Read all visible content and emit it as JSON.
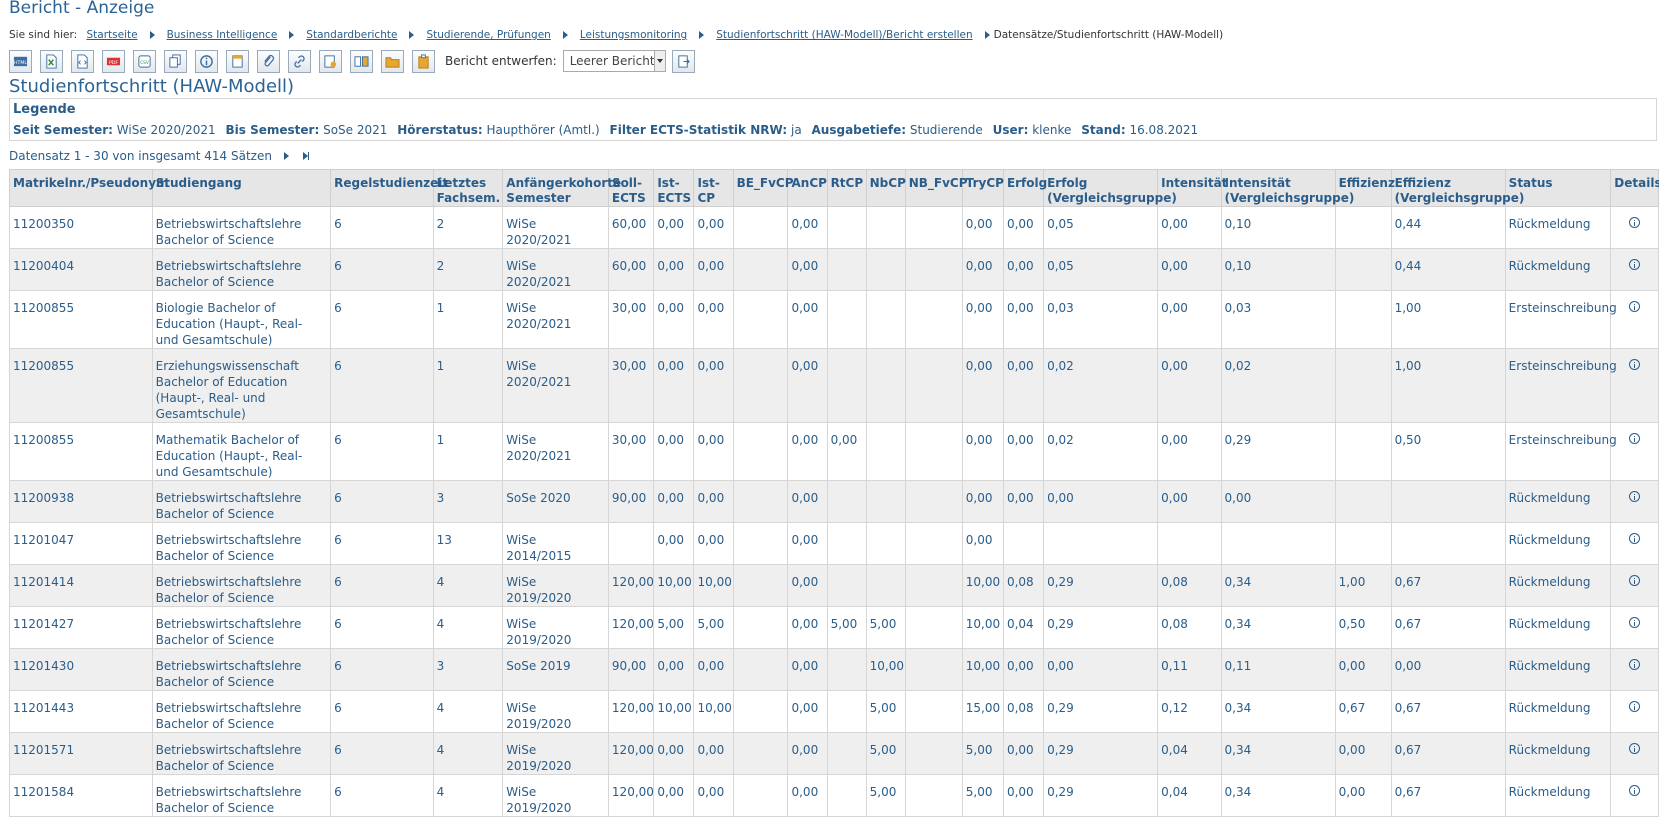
{
  "window": {
    "title": "Bericht - Anzeige"
  },
  "breadcrumb": {
    "prefix": "Sie sind hier:",
    "links": [
      "Startseite",
      "Business Intelligence",
      "Standardberichte",
      "Studierende, Prüfungen",
      "Leistungsmonitoring",
      "Studienfortschritt (HAW-Modell)/Bericht erstellen"
    ],
    "current": "Datensätze/Studienfortschritt (HAW-Modell)"
  },
  "toolbar": {
    "buttons": [
      "html-export-icon",
      "excel-export-icon",
      "xml-export-icon",
      "pdf-export-icon",
      "csv-export-icon",
      "copy-icon",
      "info-icon",
      "bookmark-icon",
      "attach-icon",
      "link-icon",
      "report-settings-icon",
      "compare-icon",
      "folder-icon",
      "clipboard-icon"
    ],
    "design_label": "Bericht entwerfen:",
    "design_value": "Leerer Bericht",
    "apply_icon": "apply-design-icon"
  },
  "report": {
    "title": "Studienfortschritt (HAW-Modell)"
  },
  "legend": {
    "title": "Legende",
    "items": [
      {
        "label": "Seit Semester:",
        "value": "WiSe 2020/2021"
      },
      {
        "label": "Bis Semester:",
        "value": "SoSe 2021"
      },
      {
        "label": "Hörerstatus:",
        "value": "Haupthörer (Amtl.)"
      },
      {
        "label": "Filter ECTS-Statistik NRW:",
        "value": "ja"
      },
      {
        "label": "Ausgabetiefe:",
        "value": "Studierende"
      },
      {
        "label": "User:",
        "value": "klenke"
      },
      {
        "label": "Stand:",
        "value": "16.08.2021"
      }
    ]
  },
  "pager": {
    "text": "Datensatz 1 - 30 von insgesamt 414 Sätzen"
  },
  "table": {
    "headers": [
      "Matrikelnr./Pseudonym",
      "Studiengang",
      "Regelstudienzeit",
      "Letztes Fachsem.",
      "Anfängerkohorte Semester",
      "Soll-ECTS",
      "Ist-ECTS",
      "Ist-CP",
      "BE_FvCP",
      "AnCP",
      "RtCP",
      "NbCP",
      "NB_FvCP",
      "TryCP",
      "Erfolg",
      "Erfolg (Vergleichsgruppe)",
      "Intensität",
      "Intensität (Vergleichsgruppe)",
      "Effizienz",
      "Effizienz (Vergleichsgruppe)",
      "Status",
      "Details"
    ],
    "rows": [
      [
        "11200350",
        "Betriebswirtschaftslehre Bachelor of Science",
        "6",
        "2",
        "WiSe 2020/2021",
        "60,00",
        "0,00",
        "0,00",
        "",
        "0,00",
        "",
        "",
        "",
        "0,00",
        "0,00",
        "0,05",
        "0,00",
        "0,10",
        "",
        "0,44",
        "Rückmeldung"
      ],
      [
        "11200404",
        "Betriebswirtschaftslehre Bachelor of Science",
        "6",
        "2",
        "WiSe 2020/2021",
        "60,00",
        "0,00",
        "0,00",
        "",
        "0,00",
        "",
        "",
        "",
        "0,00",
        "0,00",
        "0,05",
        "0,00",
        "0,10",
        "",
        "0,44",
        "Rückmeldung"
      ],
      [
        "11200855",
        "Biologie Bachelor of Education (Haupt-, Real- und Gesamtschule)",
        "6",
        "1",
        "WiSe 2020/2021",
        "30,00",
        "0,00",
        "0,00",
        "",
        "0,00",
        "",
        "",
        "",
        "0,00",
        "0,00",
        "0,03",
        "0,00",
        "0,03",
        "",
        "1,00",
        "Ersteinschreibung"
      ],
      [
        "11200855",
        "Erziehungswissenschaft Bachelor of Education (Haupt-, Real- und Gesamtschule)",
        "6",
        "1",
        "WiSe 2020/2021",
        "30,00",
        "0,00",
        "0,00",
        "",
        "0,00",
        "",
        "",
        "",
        "0,00",
        "0,00",
        "0,02",
        "0,00",
        "0,02",
        "",
        "1,00",
        "Ersteinschreibung"
      ],
      [
        "11200855",
        "Mathematik Bachelor of Education (Haupt-, Real- und Gesamtschule)",
        "6",
        "1",
        "WiSe 2020/2021",
        "30,00",
        "0,00",
        "0,00",
        "",
        "0,00",
        "0,00",
        "",
        "",
        "0,00",
        "0,00",
        "0,02",
        "0,00",
        "0,29",
        "",
        "0,50",
        "Ersteinschreibung"
      ],
      [
        "11200938",
        "Betriebswirtschaftslehre Bachelor of Science",
        "6",
        "3",
        "SoSe 2020",
        "90,00",
        "0,00",
        "0,00",
        "",
        "0,00",
        "",
        "",
        "",
        "0,00",
        "0,00",
        "0,00",
        "0,00",
        "0,00",
        "",
        "",
        "Rückmeldung"
      ],
      [
        "11201047",
        "Betriebswirtschaftslehre Bachelor of Science",
        "6",
        "13",
        "WiSe 2014/2015",
        "",
        "0,00",
        "0,00",
        "",
        "0,00",
        "",
        "",
        "",
        "0,00",
        "",
        "",
        "",
        "",
        "",
        "",
        "Rückmeldung"
      ],
      [
        "11201414",
        "Betriebswirtschaftslehre Bachelor of Science",
        "6",
        "4",
        "WiSe 2019/2020",
        "120,00",
        "10,00",
        "10,00",
        "",
        "0,00",
        "",
        "",
        "",
        "10,00",
        "0,08",
        "0,29",
        "0,08",
        "0,34",
        "1,00",
        "0,67",
        "Rückmeldung"
      ],
      [
        "11201427",
        "Betriebswirtschaftslehre Bachelor of Science",
        "6",
        "4",
        "WiSe 2019/2020",
        "120,00",
        "5,00",
        "5,00",
        "",
        "0,00",
        "5,00",
        "5,00",
        "",
        "10,00",
        "0,04",
        "0,29",
        "0,08",
        "0,34",
        "0,50",
        "0,67",
        "Rückmeldung"
      ],
      [
        "11201430",
        "Betriebswirtschaftslehre Bachelor of Science",
        "6",
        "3",
        "SoSe 2019",
        "90,00",
        "0,00",
        "0,00",
        "",
        "0,00",
        "",
        "10,00",
        "",
        "10,00",
        "0,00",
        "0,00",
        "0,11",
        "0,11",
        "0,00",
        "0,00",
        "Rückmeldung"
      ],
      [
        "11201443",
        "Betriebswirtschaftslehre Bachelor of Science",
        "6",
        "4",
        "WiSe 2019/2020",
        "120,00",
        "10,00",
        "10,00",
        "",
        "0,00",
        "",
        "5,00",
        "",
        "15,00",
        "0,08",
        "0,29",
        "0,12",
        "0,34",
        "0,67",
        "0,67",
        "Rückmeldung"
      ],
      [
        "11201571",
        "Betriebswirtschaftslehre Bachelor of Science",
        "6",
        "4",
        "WiSe 2019/2020",
        "120,00",
        "0,00",
        "0,00",
        "",
        "0,00",
        "",
        "5,00",
        "",
        "5,00",
        "0,00",
        "0,29",
        "0,04",
        "0,34",
        "0,00",
        "0,67",
        "Rückmeldung"
      ],
      [
        "11201584",
        "Betriebswirtschaftslehre Bachelor of Science",
        "6",
        "4",
        "WiSe 2019/2020",
        "120,00",
        "0,00",
        "0,00",
        "",
        "0,00",
        "",
        "5,00",
        "",
        "5,00",
        "0,00",
        "0,29",
        "0,04",
        "0,34",
        "0,00",
        "0,67",
        "Rückmeldung"
      ]
    ]
  },
  "colors": {
    "link": "#2a5d8a",
    "header_bg": "#e6e6e6",
    "row_alt_bg": "#efefef"
  }
}
